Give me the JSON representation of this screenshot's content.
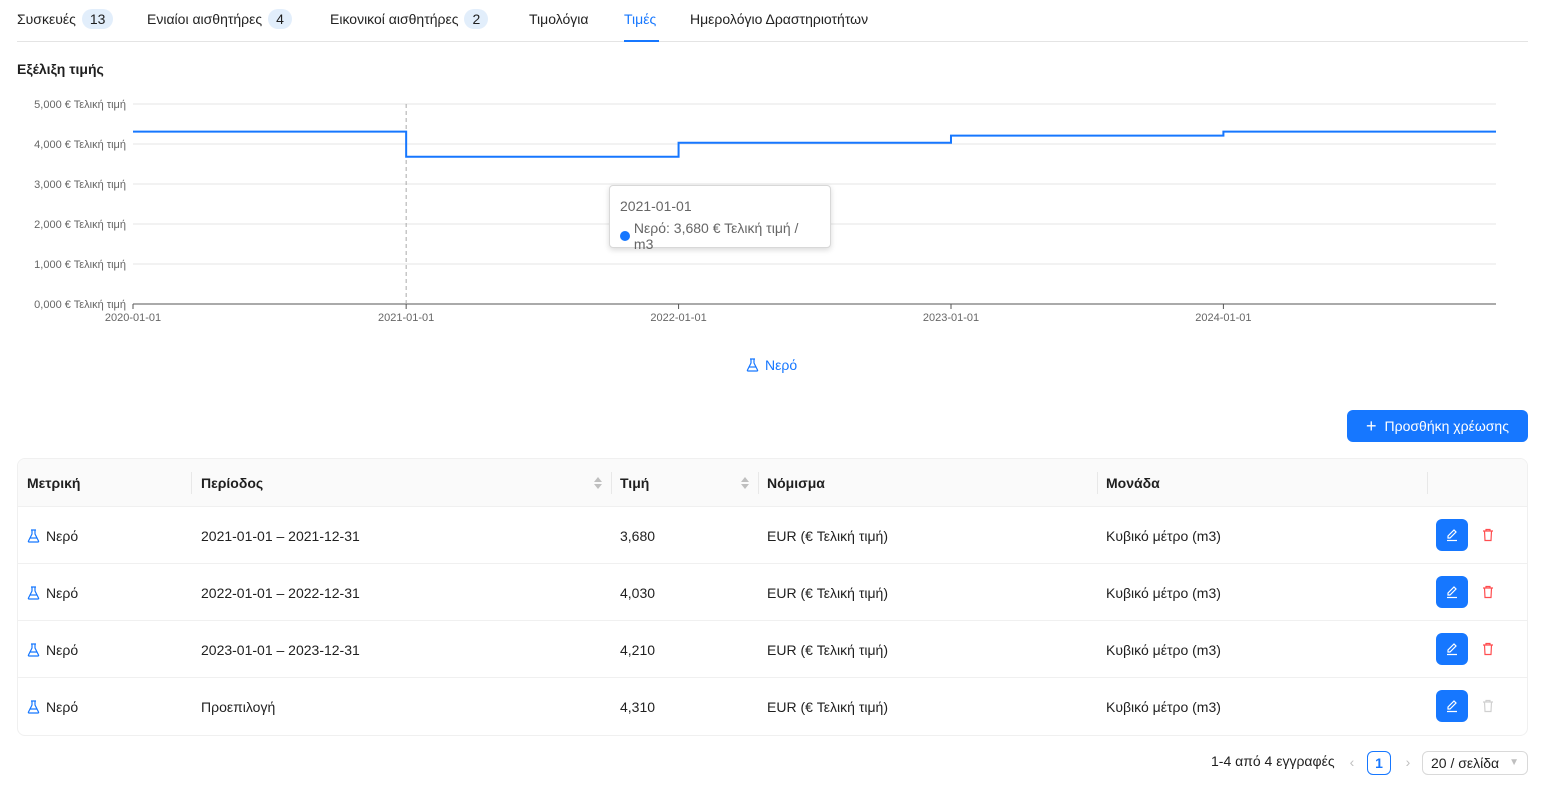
{
  "tabs": [
    {
      "label": "Συσκευές",
      "badge": "13"
    },
    {
      "label": "Ενιαίοι αισθητήρες",
      "badge": "4"
    },
    {
      "label": "Εικονικοί αισθητήρες",
      "badge": "2"
    },
    {
      "label": "Τιμολόγια",
      "badge": null
    },
    {
      "label": "Τιμές",
      "badge": null,
      "active": true
    },
    {
      "label": "Ημερολόγιο Δραστηριοτήτων",
      "badge": null
    }
  ],
  "chart": {
    "title": "Εξέλιξη τιμής",
    "legend_label": "Νερό",
    "tooltip": {
      "date": "2021-01-01",
      "text": "Νερό: 3,680 € Τελική τιμή / m3"
    }
  },
  "chart_data": {
    "type": "line",
    "step": true,
    "series": [
      {
        "name": "Νερό",
        "color": "#1677ff",
        "points": [
          {
            "x": "2020-01-01",
            "y": 4310
          },
          {
            "x": "2021-01-01",
            "y": 3680
          },
          {
            "x": "2022-01-01",
            "y": 4030
          },
          {
            "x": "2023-01-01",
            "y": 4210
          },
          {
            "x": "2024-01-01",
            "y": 4310
          },
          {
            "x": "2024-12-31",
            "y": 4310
          }
        ]
      }
    ],
    "y_ticks": [
      "0,000 € Τελική τιμή",
      "1,000 € Τελική τιμή",
      "2,000 € Τελική τιμή",
      "3,000 € Τελική τιμή",
      "4,000 € Τελική τιμή",
      "5,000 € Τελική τιμή"
    ],
    "x_ticks": [
      "2020-01-01",
      "2021-01-01",
      "2022-01-01",
      "2023-01-01",
      "2024-01-01"
    ],
    "ylim": [
      0,
      5000
    ],
    "grid": true,
    "legend": "bottom-center",
    "hover_x": "2021-01-01"
  },
  "actions": {
    "add_label": "Προσθήκη χρέωσης"
  },
  "table": {
    "columns": [
      "Μετρική",
      "Περίοδος",
      "Τιμή",
      "Νόμισμα",
      "Μονάδα"
    ],
    "rows": [
      {
        "metric": "Νερό",
        "period": "2021-01-01 – 2021-12-31",
        "price": "3,680",
        "currency": "EUR (€ Τελική τιμή)",
        "unit": "Κυβικό μέτρο (m3)",
        "deletable": true
      },
      {
        "metric": "Νερό",
        "period": "2022-01-01 – 2022-12-31",
        "price": "4,030",
        "currency": "EUR (€ Τελική τιμή)",
        "unit": "Κυβικό μέτρο (m3)",
        "deletable": true
      },
      {
        "metric": "Νερό",
        "period": "2023-01-01 – 2023-12-31",
        "price": "4,210",
        "currency": "EUR (€ Τελική τιμή)",
        "unit": "Κυβικό μέτρο (m3)",
        "deletable": true
      },
      {
        "metric": "Νερό",
        "period": "Προεπιλογή",
        "price": "4,310",
        "currency": "EUR (€ Τελική τιμή)",
        "unit": "Κυβικό μέτρο (m3)",
        "deletable": false
      }
    ]
  },
  "pagination": {
    "total": "1-4 από 4 εγγραφές",
    "current": "1",
    "page_size": "20 / σελίδα"
  },
  "colors": {
    "accent": "#1677ff",
    "danger": "#ff4d4f",
    "disabled": "#bfbfbf"
  }
}
